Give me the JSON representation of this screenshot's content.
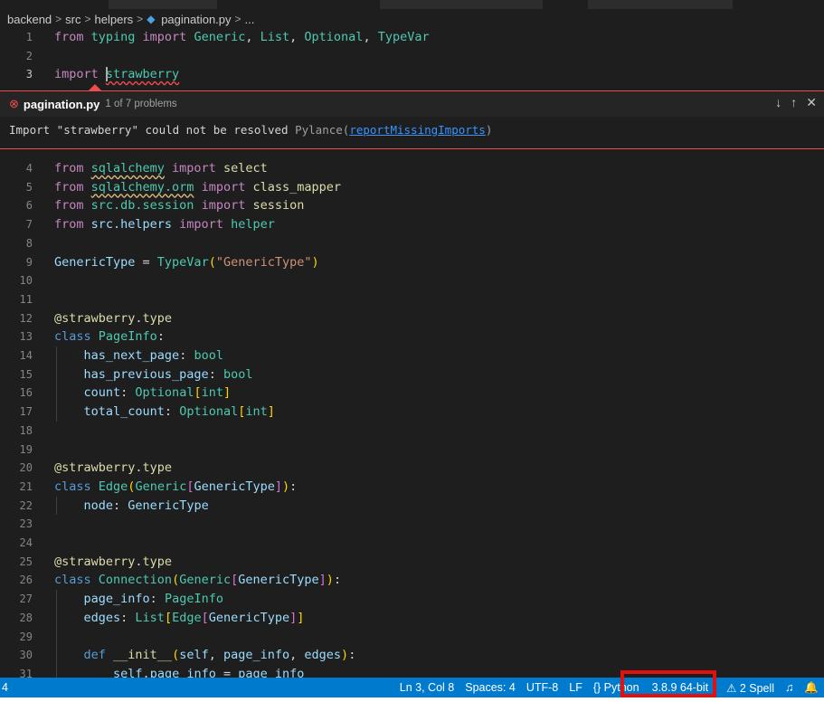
{
  "breadcrumb": {
    "items": [
      "backend",
      "src",
      "helpers",
      "pagination.py",
      "..."
    ],
    "separator": ">"
  },
  "editor": {
    "lines_top": [
      {
        "num": "1",
        "tokens": [
          [
            "kw2",
            "from "
          ],
          [
            "mod",
            "typing "
          ],
          [
            "kw2",
            "import "
          ],
          [
            "cls",
            "Generic"
          ],
          [
            "pl",
            ", "
          ],
          [
            "cls",
            "List"
          ],
          [
            "pl",
            ", "
          ],
          [
            "cls",
            "Optional"
          ],
          [
            "pl",
            ", "
          ],
          [
            "cls",
            "TypeVar"
          ]
        ]
      },
      {
        "num": "2",
        "tokens": []
      },
      {
        "num": "3",
        "tokens": [
          [
            "kw2",
            "import "
          ],
          [
            "mod",
            "strawberry"
          ]
        ]
      }
    ],
    "lines": [
      {
        "num": "4",
        "tokens": [
          [
            "kw2",
            "from "
          ],
          [
            "mod",
            "sqlalchemy"
          ],
          [
            "kw2",
            " import "
          ],
          [
            "fn",
            "select"
          ]
        ]
      },
      {
        "num": "5",
        "tokens": [
          [
            "kw2",
            "from "
          ],
          [
            "mod",
            "sqlalchemy.orm"
          ],
          [
            "kw2",
            " import "
          ],
          [
            "fn",
            "class_mapper"
          ]
        ]
      },
      {
        "num": "6",
        "tokens": [
          [
            "kw2",
            "from "
          ],
          [
            "mod",
            "src.db.session"
          ],
          [
            "kw2",
            " import "
          ],
          [
            "fn",
            "session"
          ]
        ]
      },
      {
        "num": "7",
        "tokens": [
          [
            "kw2",
            "from "
          ],
          [
            "var",
            "src.helpers"
          ],
          [
            "kw2",
            " import "
          ],
          [
            "mod",
            "helper"
          ]
        ]
      },
      {
        "num": "8",
        "tokens": []
      },
      {
        "num": "9",
        "tokens": [
          [
            "var",
            "GenericType"
          ],
          [
            "pl",
            " = "
          ],
          [
            "cls",
            "TypeVar"
          ],
          [
            "br1",
            "("
          ],
          [
            "str",
            "\"GenericType\""
          ],
          [
            "br1",
            ")"
          ]
        ]
      },
      {
        "num": "10",
        "tokens": []
      },
      {
        "num": "11",
        "tokens": []
      },
      {
        "num": "12",
        "tokens": [
          [
            "dec",
            "@strawberry"
          ],
          [
            "pl",
            "."
          ],
          [
            "fn",
            "type"
          ]
        ]
      },
      {
        "num": "13",
        "tokens": [
          [
            "kw",
            "class "
          ],
          [
            "cls",
            "PageInfo"
          ],
          [
            "pl",
            ":"
          ]
        ]
      },
      {
        "num": "14",
        "tokens": [
          [
            "pl",
            "    "
          ],
          [
            "var",
            "has_next_page"
          ],
          [
            "pl",
            ": "
          ],
          [
            "cls",
            "bool"
          ]
        ]
      },
      {
        "num": "15",
        "tokens": [
          [
            "pl",
            "    "
          ],
          [
            "var",
            "has_previous_page"
          ],
          [
            "pl",
            ": "
          ],
          [
            "cls",
            "bool"
          ]
        ]
      },
      {
        "num": "16",
        "tokens": [
          [
            "pl",
            "    "
          ],
          [
            "var",
            "count"
          ],
          [
            "pl",
            ": "
          ],
          [
            "cls",
            "Optional"
          ],
          [
            "br1",
            "["
          ],
          [
            "cls",
            "int"
          ],
          [
            "br1",
            "]"
          ]
        ]
      },
      {
        "num": "17",
        "tokens": [
          [
            "pl",
            "    "
          ],
          [
            "var",
            "total_count"
          ],
          [
            "pl",
            ": "
          ],
          [
            "cls",
            "Optional"
          ],
          [
            "br1",
            "["
          ],
          [
            "cls",
            "int"
          ],
          [
            "br1",
            "]"
          ]
        ]
      },
      {
        "num": "18",
        "tokens": []
      },
      {
        "num": "19",
        "tokens": []
      },
      {
        "num": "20",
        "tokens": [
          [
            "dec",
            "@strawberry"
          ],
          [
            "pl",
            "."
          ],
          [
            "fn",
            "type"
          ]
        ]
      },
      {
        "num": "21",
        "tokens": [
          [
            "kw",
            "class "
          ],
          [
            "cls",
            "Edge"
          ],
          [
            "br1",
            "("
          ],
          [
            "cls",
            "Generic"
          ],
          [
            "br2",
            "["
          ],
          [
            "var",
            "GenericType"
          ],
          [
            "br2",
            "]"
          ],
          [
            "br1",
            ")"
          ],
          [
            "pl",
            ":"
          ]
        ]
      },
      {
        "num": "22",
        "tokens": [
          [
            "pl",
            "    "
          ],
          [
            "var",
            "node"
          ],
          [
            "pl",
            ": "
          ],
          [
            "var",
            "GenericType"
          ]
        ]
      },
      {
        "num": "23",
        "tokens": []
      },
      {
        "num": "24",
        "tokens": []
      },
      {
        "num": "25",
        "tokens": [
          [
            "dec",
            "@strawberry"
          ],
          [
            "pl",
            "."
          ],
          [
            "fn",
            "type"
          ]
        ]
      },
      {
        "num": "26",
        "tokens": [
          [
            "kw",
            "class "
          ],
          [
            "cls",
            "Connection"
          ],
          [
            "br1",
            "("
          ],
          [
            "cls",
            "Generic"
          ],
          [
            "br2",
            "["
          ],
          [
            "var",
            "GenericType"
          ],
          [
            "br2",
            "]"
          ],
          [
            "br1",
            ")"
          ],
          [
            "pl",
            ":"
          ]
        ]
      },
      {
        "num": "27",
        "tokens": [
          [
            "pl",
            "    "
          ],
          [
            "var",
            "page_info"
          ],
          [
            "pl",
            ": "
          ],
          [
            "cls",
            "PageInfo"
          ]
        ]
      },
      {
        "num": "28",
        "tokens": [
          [
            "pl",
            "    "
          ],
          [
            "var",
            "edges"
          ],
          [
            "pl",
            ": "
          ],
          [
            "cls",
            "List"
          ],
          [
            "br1",
            "["
          ],
          [
            "cls",
            "Edge"
          ],
          [
            "br2",
            "["
          ],
          [
            "var",
            "GenericType"
          ],
          [
            "br2",
            "]"
          ],
          [
            "br1",
            "]"
          ]
        ]
      },
      {
        "num": "29",
        "tokens": []
      },
      {
        "num": "30",
        "tokens": [
          [
            "pl",
            "    "
          ],
          [
            "kw",
            "def "
          ],
          [
            "fn",
            "__init__"
          ],
          [
            "br1",
            "("
          ],
          [
            "var",
            "self"
          ],
          [
            "pl",
            ", "
          ],
          [
            "var",
            "page_info"
          ],
          [
            "pl",
            ", "
          ],
          [
            "var",
            "edges"
          ],
          [
            "br1",
            ")"
          ],
          [
            "pl",
            ":"
          ]
        ]
      },
      {
        "num": "31",
        "tokens": [
          [
            "pl",
            "        "
          ],
          [
            "var",
            "self"
          ],
          [
            "pl",
            "."
          ],
          [
            "var",
            "page_info"
          ],
          [
            "pl",
            " = "
          ],
          [
            "var",
            "page_info"
          ]
        ]
      }
    ]
  },
  "peek": {
    "file": "pagination.py",
    "count": "1 of 7 problems",
    "message": "Import \"strawberry\" could not be resolved",
    "source": "Pylance",
    "rule": "reportMissingImports"
  },
  "statusbar": {
    "left": "4",
    "items": [
      "Ln 3, Col 8",
      "Spaces: 4",
      "UTF-8",
      "LF",
      "{} Python",
      "3.8.9 64-bit",
      "⚠ 2 Spell",
      "♫",
      "🔔"
    ]
  },
  "colors": {
    "accent": "#007acc",
    "error": "#f14c4c",
    "highlight": "#e31010"
  }
}
